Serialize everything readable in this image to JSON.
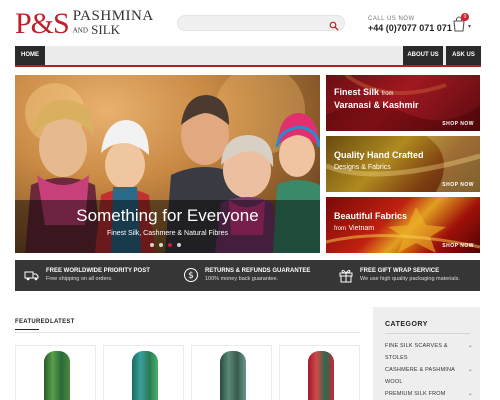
{
  "header": {
    "logo_mark": "P&S",
    "logo_word1": "PASHMINA",
    "logo_and": "AND",
    "logo_word2": "SILK",
    "search_placeholder": "",
    "call_label": "CALL US NOW",
    "phone": "+44 (0)7077 071 071",
    "cart_count": "0"
  },
  "nav": {
    "home": "HOME",
    "about": "ABOUT US",
    "ask": "ASK US"
  },
  "hero": {
    "title": "Something for Everyone",
    "subtitle": "Finest Silk, Cashmere & Natural Fibres",
    "slides": 4,
    "active_slide": 2
  },
  "promos": [
    {
      "line1": "Finest Silk",
      "line1_small": "from",
      "line2": "Varanasi & Kashmir",
      "cta": "SHOP NOW"
    },
    {
      "line1": "Quality Hand Crafted",
      "line2": "Designs & Fabrics",
      "cta": "SHOP NOW"
    },
    {
      "line1": "Beautiful Fabrics",
      "line2_small": "from",
      "line2": "Vietnam",
      "cta": "SHOP NOW"
    }
  ],
  "features": [
    {
      "icon": "truck-icon",
      "title": "FREE WORLDWIDE PRIORITY POST",
      "sub": "Free shipping on all orders."
    },
    {
      "icon": "dollar-icon",
      "title": "RETURNS & REFUNDS GUARANTEE",
      "sub": "100% money back guarantee."
    },
    {
      "icon": "gift-icon",
      "title": "FREE GIFT WRAP SERVICE",
      "sub": "We use high quality packaging materials."
    }
  ],
  "tabs": [
    "FEATURED",
    "LATEST"
  ],
  "sidebar": {
    "heading": "CATEGORY",
    "items": [
      "FINE SILK SCARVES &",
      "STOLES",
      "CASHMERE & PASHMINA",
      "WOOL",
      "PREMIUM SILK FROM"
    ]
  },
  "colors": {
    "brand_red": "#c0202a",
    "nav_dark": "#2a2a2a",
    "features_bg": "#363636"
  }
}
